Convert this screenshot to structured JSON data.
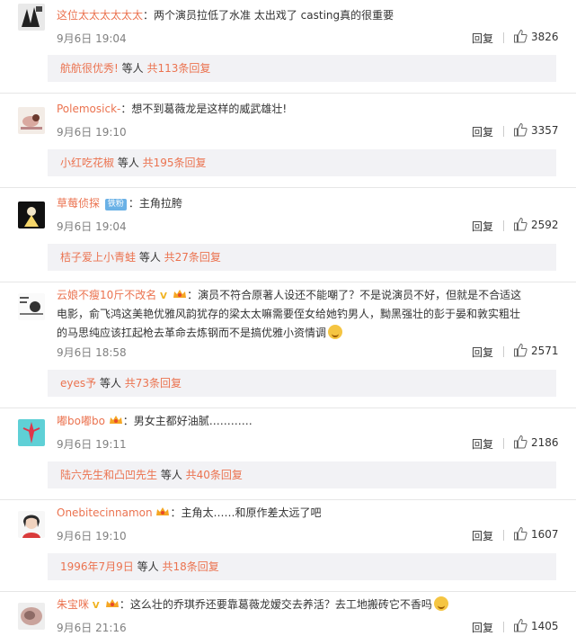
{
  "comments": [
    {
      "user": "这位太太太太太太",
      "text": "两个演员拉低了水准 太出戏了 casting真的很重要",
      "time": "9月6日 19:04",
      "reply": "回复",
      "likes": "3826",
      "sub_names": "航航很优秀!",
      "sub_mid": " 等人 ",
      "sub_count": "共113条回复"
    },
    {
      "user": "Polemosick-",
      "text": "想不到葛薇龙是这样的威武雄壮!",
      "time": "9月6日 19:10",
      "reply": "回复",
      "likes": "3357",
      "sub_names": "小红吃花椒",
      "sub_mid": " 等人 ",
      "sub_count": "共195条回复"
    },
    {
      "user": "草莓侦探",
      "badge": "铁粉",
      "text": "主角拉胯",
      "time": "9月6日 19:04",
      "reply": "回复",
      "likes": "2592",
      "sub_names": "桔子爱上小青蛙",
      "sub_mid": " 等人 ",
      "sub_count": "共27条回复"
    },
    {
      "user": "云娘不瘦10斤不改名",
      "line1": "演员不符合原著人设还不能嘲了？不是说演员不好，但就是不合适这",
      "line2": "电影，俞飞鸿这美艳优雅风韵犹存的梁太太嘛需要侄女给她钓男人，黝黑强壮的彭于晏和敦实粗壮",
      "line3": "的马思纯应该扛起枪去革命去炼钢而不是搞优雅小资情调",
      "time": "9月6日 18:58",
      "reply": "回复",
      "likes": "2571",
      "sub_names": "eyes予",
      "sub_mid": " 等人 ",
      "sub_count": "共73条回复"
    },
    {
      "user": "嘟bo嘟bo",
      "text": "男女主都好油腻…………",
      "time": "9月6日 19:11",
      "reply": "回复",
      "likes": "2186",
      "sub_names": "陆六先生和凸凹先生",
      "sub_mid": " 等人 ",
      "sub_count": "共40条回复"
    },
    {
      "user": "Onebitecinnamon",
      "text": "主角太……和原作差太远了吧",
      "time": "9月6日 19:10",
      "reply": "回复",
      "likes": "1607",
      "sub_names": "1996年7月9日",
      "sub_mid": " 等人 ",
      "sub_count": "共18条回复"
    },
    {
      "user": "朱宝咪",
      "text": "这么壮的乔琪乔还要靠葛薇龙嫒交去养活？去工地搬砖它不香吗",
      "time": "9月6日 21:16",
      "reply": "回复",
      "likes": "1405"
    }
  ],
  "colors": {
    "link": "#eb7350",
    "time": "#808080",
    "sub_bg": "#f2f2f5"
  }
}
